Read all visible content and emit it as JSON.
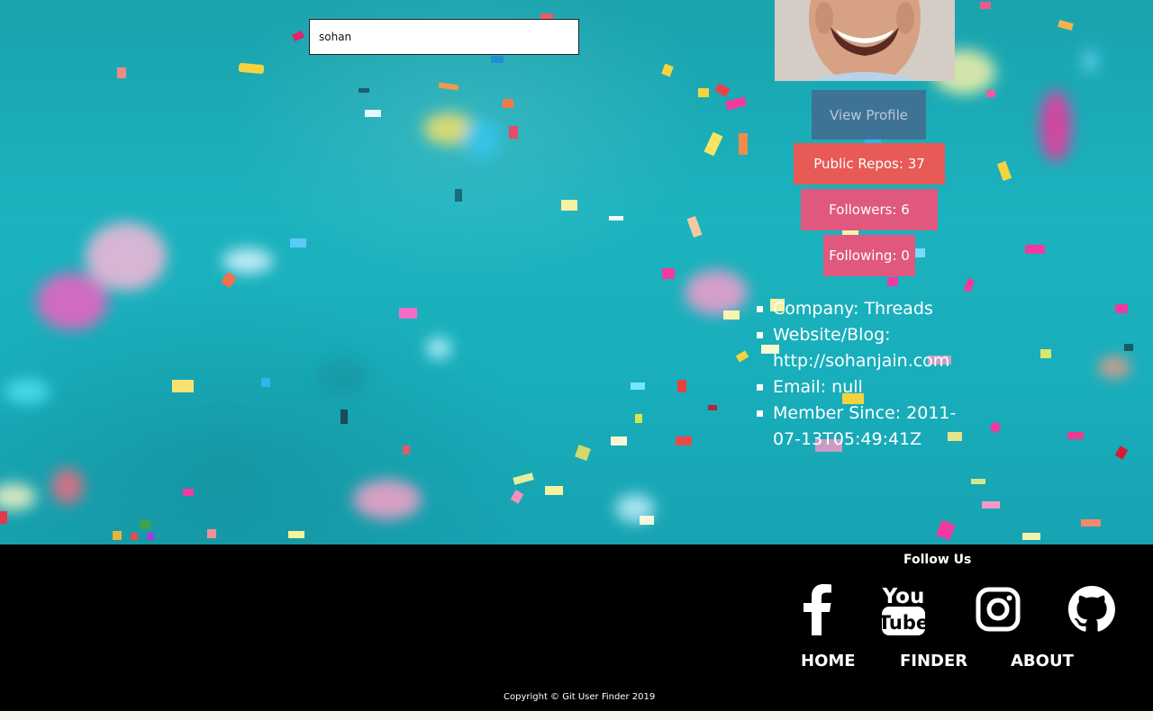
{
  "search": {
    "value": "sohan",
    "placeholder": ""
  },
  "profile": {
    "view_label": "View Profile",
    "repos_label": "Public Repos: 37",
    "followers_label": "Followers: 6",
    "following_label": "Following: 0",
    "details": [
      "Company: Threads",
      "Website/Blog: http://sohanjain.com",
      "Email: null",
      "Member Since: 2011-07-13T05:49:41Z"
    ]
  },
  "footer": {
    "follow_title": "Follow Us",
    "social": [
      "facebook-icon",
      "youtube-icon",
      "instagram-icon",
      "github-icon"
    ],
    "youtube_word_top": "You",
    "youtube_word_bottom": "Tube",
    "nav": [
      "HOME",
      "FINDER",
      "ABOUT"
    ],
    "copyright": "Copyright © Git User Finder 2019"
  },
  "colors": {
    "background": "#1bb3be",
    "view_button": "#3f7396",
    "repos_button": "#e85a55",
    "followers_button": "#e0587e",
    "footer": "#000000"
  }
}
